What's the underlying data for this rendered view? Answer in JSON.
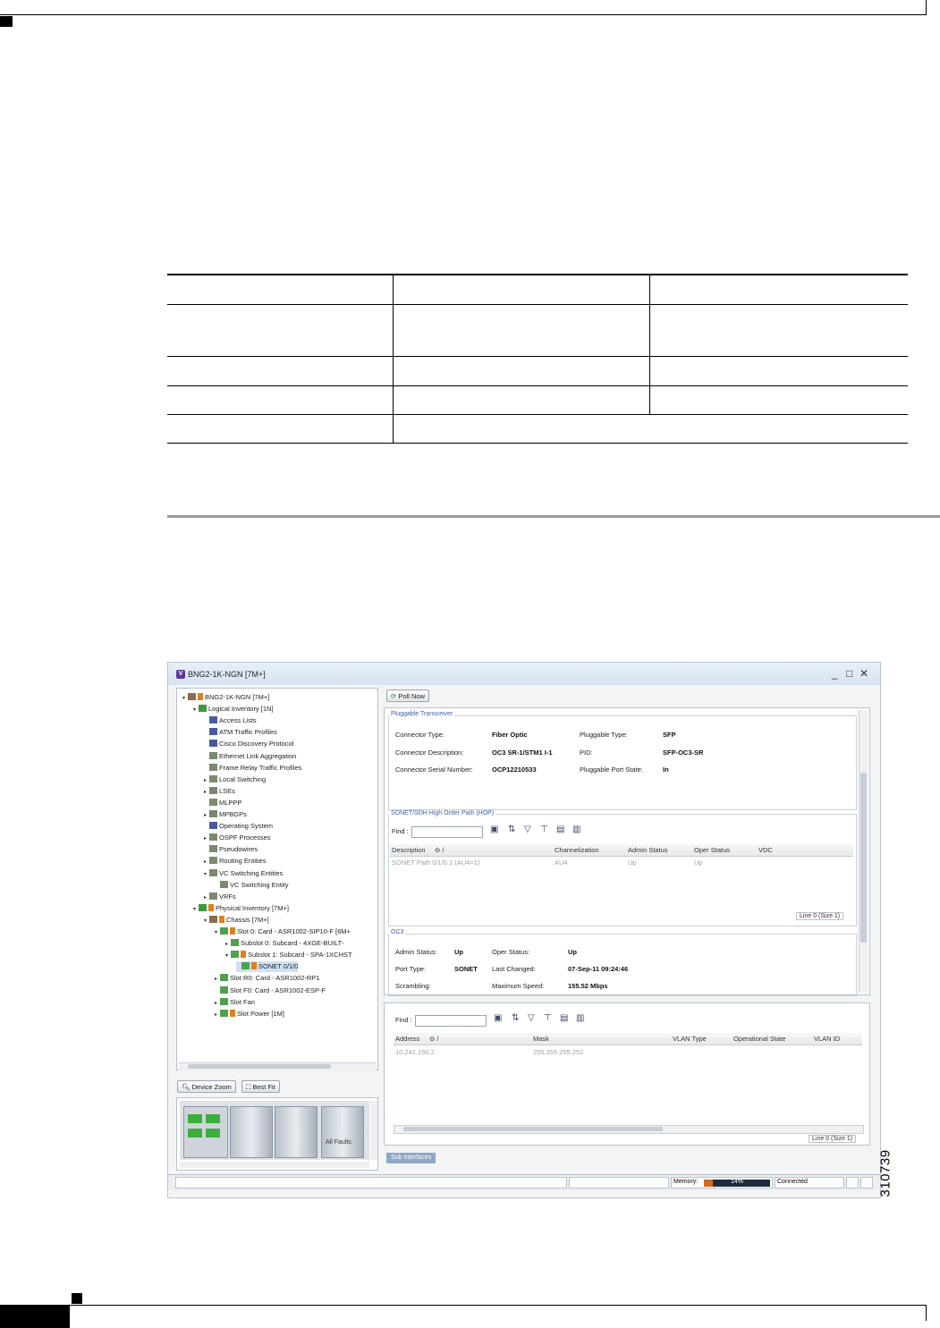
{
  "figure": {
    "number": "310739"
  },
  "window": {
    "title": "BNG2-1K-NGN [7M+]",
    "controls": {
      "minimize": "_",
      "maximize": "□",
      "close": "✕"
    }
  },
  "tree": {
    "items": [
      {
        "label": "BNG2-1K-NGN [7M+]",
        "level": 0,
        "expander": "▾"
      },
      {
        "label": "Logical Inventory [1N]",
        "level": 1,
        "expander": "▾"
      },
      {
        "label": "Access Lists",
        "level": 2,
        "expander": ""
      },
      {
        "label": "ATM Traffic Profiles",
        "level": 2,
        "expander": ""
      },
      {
        "label": "Cisco Discovery Protocol",
        "level": 2,
        "expander": ""
      },
      {
        "label": "Ethernet Link Aggregation",
        "level": 2,
        "expander": ""
      },
      {
        "label": "Frame Relay Traffic Profiles",
        "level": 2,
        "expander": ""
      },
      {
        "label": "Local Switching",
        "level": 2,
        "expander": "▸"
      },
      {
        "label": "LSEs",
        "level": 2,
        "expander": "▸"
      },
      {
        "label": "MLPPP",
        "level": 2,
        "expander": ""
      },
      {
        "label": "MPBGPs",
        "level": 2,
        "expander": "▸"
      },
      {
        "label": "Operating System",
        "level": 2,
        "expander": ""
      },
      {
        "label": "OSPF Processes",
        "level": 2,
        "expander": "▸"
      },
      {
        "label": "Pseudowires",
        "level": 2,
        "expander": ""
      },
      {
        "label": "Routing Entities",
        "level": 2,
        "expander": "▸"
      },
      {
        "label": "VC Switching Entities",
        "level": 2,
        "expander": "▾"
      },
      {
        "label": "VC Switching Entity",
        "level": 3,
        "expander": ""
      },
      {
        "label": "VRFs",
        "level": 2,
        "expander": "▸"
      },
      {
        "label": "Physical Inventory [7M+]",
        "level": 1,
        "expander": "▾"
      },
      {
        "label": "Chassis [7M+]",
        "level": 2,
        "expander": "▾"
      },
      {
        "label": "Slot 0: Card - ASR1002-SIP10-F [6M+",
        "level": 3,
        "expander": "▾"
      },
      {
        "label": "Subslot 0: Subcard - 4XGE-BUILT-",
        "level": 4,
        "expander": "▸"
      },
      {
        "label": "Subslot 1: Subcard - SPA-1XCHST",
        "level": 4,
        "expander": "▾"
      },
      {
        "label": "SONET 0/1/0",
        "level": 5,
        "expander": ""
      },
      {
        "label": "Slot R0: Card - ASR1002-RP1",
        "level": 3,
        "expander": "▸"
      },
      {
        "label": "Slot F0: Card - ASR1002-ESP-F",
        "level": 3,
        "expander": ""
      },
      {
        "label": "Slot Fan",
        "level": 3,
        "expander": "▸"
      },
      {
        "label": "Slot Power [1M]",
        "level": 3,
        "expander": "▸"
      }
    ]
  },
  "view_buttons": {
    "device_zoom": "Device Zoom",
    "best_fit": "Best Fit"
  },
  "chassis_view": {
    "overlay_text": "All Faults"
  },
  "toolbar": {
    "poll_now": "Poll Now"
  },
  "pluggable": {
    "title": "Pluggable Transceiver",
    "connector_type_label": "Connector Type:",
    "connector_type_value": "Fiber Optic",
    "pluggable_type_label": "Pluggable Type:",
    "pluggable_type_value": "SFP",
    "connector_desc_label": "Connector Description:",
    "connector_desc_value": "OC3 SR-1/STM1 I-1",
    "pid_label": "PID:",
    "pid_value": "SFP-OC3-SR",
    "serial_label": "Connector Serial Number:",
    "serial_value": "OCP12210533",
    "port_state_label": "Pluggable Port State:",
    "port_state_value": "In"
  },
  "hop": {
    "title": "SONET/SDH High Order Path (HOP)",
    "find_label": "Find :",
    "columns": [
      "Description",
      "Channelization",
      "Admin Status",
      "Oper Status",
      "VDC"
    ],
    "rows": [
      [
        "SONET Path 0/1/0.1 (AU4=1)",
        "AU4",
        "Up",
        "Up",
        ""
      ]
    ],
    "count": "Line 0 (Size 1)"
  },
  "oc3": {
    "title": "OC3",
    "admin_status_label": "Admin Status:",
    "admin_status_value": "Up",
    "oper_status_label": "Oper Status:",
    "oper_status_value": "Up",
    "port_type_label": "Port Type:",
    "port_type_value": "SONET",
    "last_changed_label": "Last Changed:",
    "last_changed_value": "07-Sep-11 09:24:46",
    "scrambling_label": "Scrambling:",
    "max_speed_label": "Maximum Speed:",
    "max_speed_value": "155.52 Mbps"
  },
  "ip_table": {
    "find_label": "Find :",
    "columns": [
      "Address",
      "Mask",
      "VLAN Type",
      "Operational State",
      "VLAN ID"
    ],
    "rows": [
      [
        "10.242.150.2",
        "255.255.255.252",
        "",
        "",
        ""
      ]
    ],
    "count": "Line 0 (Size 1)"
  },
  "tabs": {
    "sub_interfaces": "Sub Interfaces"
  },
  "status": {
    "memory_label": "Memory:",
    "memory_percent": 14,
    "memory_text": "14%",
    "connection": "Connected"
  }
}
